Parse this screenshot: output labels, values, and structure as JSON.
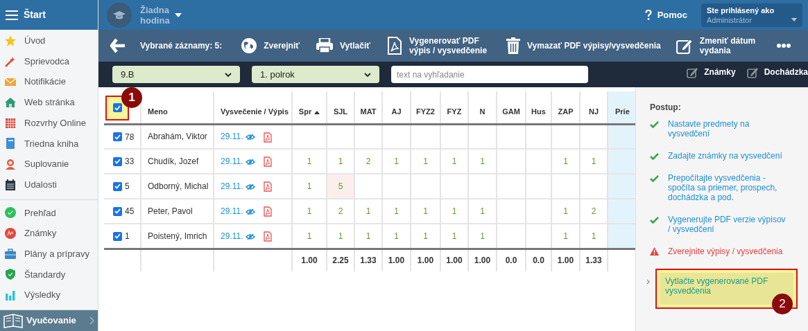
{
  "topbar": {
    "menu_label": "Štart",
    "lesson": "Žiadna hodina",
    "help": "Pomoc",
    "user_label": "Ste prihlásený ako",
    "user": "Administrátor"
  },
  "sidebar": {
    "groups": [
      [
        "Úvod",
        "Sprievodca",
        "Notifikácie",
        "Web stránka",
        "Rozvrhy Online",
        "Triedna kniha",
        "Suplovanie",
        "Udalosti"
      ],
      [
        "Prehľad",
        "Známky",
        "Plány a prípravy",
        "Štandardy",
        "Výsledky"
      ]
    ],
    "footer": "Vyučovanie"
  },
  "toolbar": {
    "selected_label": "Vybrané záznamy: 5:",
    "actions": [
      "Zverejniť",
      "Vytlačiť",
      "Vygenerovať PDF výpis / vysvedčenie",
      "Vymazať PDF výpisy/vysvedčenia",
      "Zmeniť dátum vydania"
    ]
  },
  "filters": {
    "class": "9.B",
    "period": "1. polrok",
    "search_placeholder": "text na vyhľadanie",
    "links": [
      "Známky",
      "Dochádzka"
    ]
  },
  "table": {
    "select_all": {
      "checked": true
    },
    "columns": [
      {
        "label": "Meno",
        "sorted": false
      },
      {
        "label": "Vysvečenie / Výpis",
        "sorted": false
      },
      {
        "label": "Spr",
        "sorted": true
      },
      {
        "label": "SJL",
        "sorted": false
      },
      {
        "label": "MAT",
        "sorted": false
      },
      {
        "label": "AJ",
        "sorted": false
      },
      {
        "label": "FYZ2",
        "sorted": false
      },
      {
        "label": "FYZ",
        "sorted": false
      },
      {
        "label": "N",
        "sorted": false
      },
      {
        "label": "GAM",
        "sorted": false
      },
      {
        "label": "Hus",
        "sorted": false
      },
      {
        "label": "ZAP",
        "sorted": false
      },
      {
        "label": "NJ",
        "sorted": false
      },
      {
        "label": "Prie",
        "sorted": false
      }
    ],
    "rows": [
      {
        "checked": true,
        "number": "78",
        "name": "Abrahám, Viktor",
        "date": "29.11.",
        "grades": [
          {
            "flagged": false
          },
          {
            "flagged": false
          },
          {
            "flagged": false
          },
          {
            "flagged": false
          },
          {
            "flagged": false
          },
          {
            "flagged": false
          },
          {
            "flagged": false
          },
          {
            "flagged": false
          },
          {
            "flagged": false
          },
          {
            "flagged": false
          },
          {
            "flagged": false
          }
        ]
      },
      {
        "checked": true,
        "number": "33",
        "name": "Chudík, Jozef",
        "date": "29.11.",
        "grades": [
          {
            "text": "1",
            "flagged": false
          },
          {
            "text": "1",
            "flagged": false
          },
          {
            "text": "2",
            "flagged": false
          },
          {
            "text": "1",
            "flagged": false
          },
          {
            "text": "1",
            "flagged": false
          },
          {
            "text": "1",
            "flagged": false
          },
          {
            "text": "1",
            "flagged": false
          },
          {
            "flagged": false
          },
          {
            "flagged": false
          },
          {
            "text": "1",
            "flagged": false
          },
          {
            "text": "1",
            "flagged": false
          }
        ]
      },
      {
        "checked": true,
        "number": "5",
        "name": "Odborný, Michal",
        "date": "29.11.",
        "grades": [
          {
            "text": "1",
            "flagged": false
          },
          {
            "text": "5",
            "flagged": true
          },
          {
            "flagged": false
          },
          {
            "flagged": false
          },
          {
            "flagged": false
          },
          {
            "flagged": false
          },
          {
            "flagged": false
          },
          {
            "flagged": false
          },
          {
            "flagged": false
          },
          {
            "flagged": false
          },
          {
            "flagged": false
          }
        ]
      },
      {
        "checked": true,
        "number": "45",
        "name": "Peter, Pavol",
        "date": "29.11.",
        "grades": [
          {
            "text": "1",
            "flagged": false
          },
          {
            "text": "2",
            "flagged": false
          },
          {
            "text": "1",
            "flagged": false
          },
          {
            "text": "1",
            "flagged": false
          },
          {
            "text": "1",
            "flagged": false
          },
          {
            "text": "1",
            "flagged": false
          },
          {
            "text": "1",
            "flagged": false
          },
          {
            "flagged": false
          },
          {
            "flagged": false
          },
          {
            "text": "1",
            "flagged": false
          },
          {
            "text": "2",
            "flagged": false
          }
        ]
      },
      {
        "checked": true,
        "number": "1",
        "name": "Poistený, Imrich",
        "date": "29.11.",
        "grades": [
          {
            "text": "1",
            "flagged": false
          },
          {
            "text": "1",
            "flagged": false
          },
          {
            "text": "1",
            "flagged": false
          },
          {
            "text": "1",
            "flagged": false
          },
          {
            "text": "1",
            "flagged": false
          },
          {
            "text": "1",
            "flagged": false
          },
          {
            "text": "1",
            "flagged": false
          },
          {
            "flagged": false
          },
          {
            "flagged": false
          },
          {
            "text": "1",
            "flagged": false
          },
          {
            "text": "1",
            "flagged": false
          }
        ]
      }
    ],
    "totals": [
      "1.00",
      "2.25",
      "1.33",
      "1.00",
      "1.00",
      "1.00",
      "1.00",
      "0.0",
      "0.0",
      "1.00",
      "1.33"
    ]
  },
  "steps_panel": {
    "title": "Postup:",
    "steps": [
      {
        "kind": "done",
        "text": "Nastavte predmety na vysvedčení"
      },
      {
        "kind": "done",
        "text": "Zadajte známky na vysvedčení"
      },
      {
        "kind": "done",
        "text": "Prepočítajte vysvedčenia - spočíta sa priemer, prospech, dochádzka a pod."
      },
      {
        "kind": "done",
        "text": "Vygenerujte PDF verzie výpisov / vysvedčení"
      },
      {
        "kind": "warning",
        "text": "Zverejnite výpisy / vysvedčenia"
      },
      {
        "kind": "current",
        "text": "Vytlačte vygenerované PDF vysvedčenia"
      }
    ]
  },
  "callouts": [
    "1",
    "2"
  ]
}
